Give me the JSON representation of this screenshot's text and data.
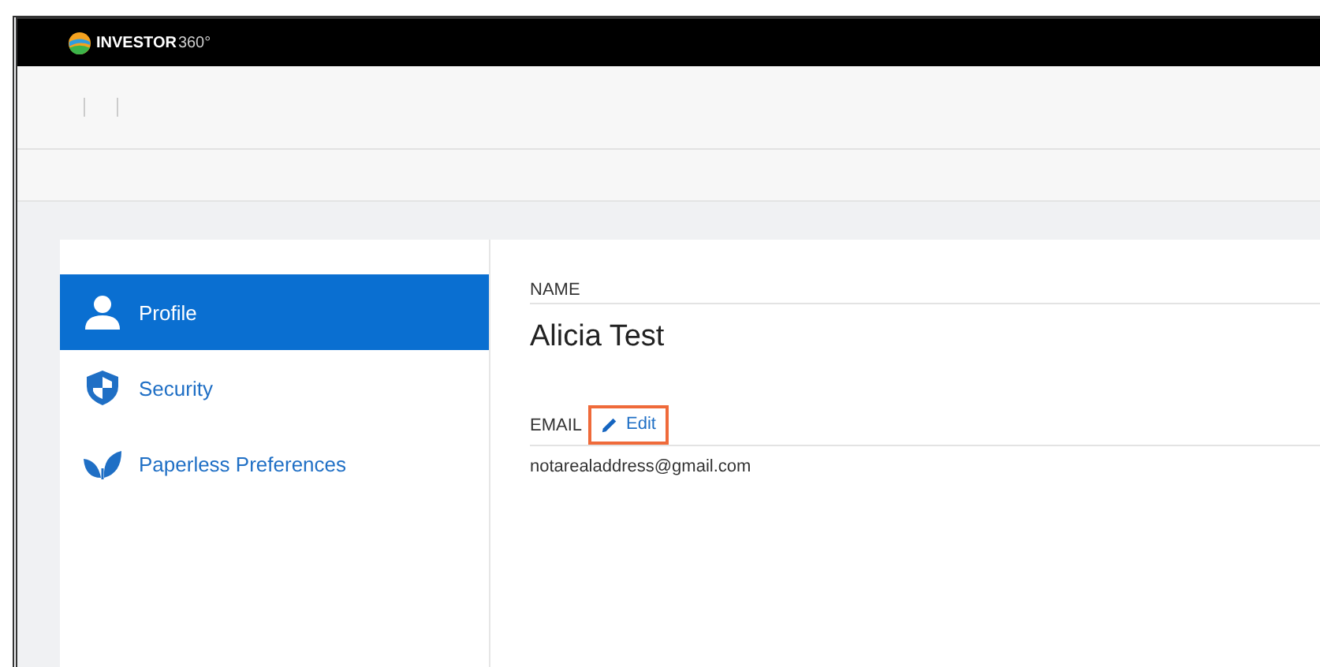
{
  "header": {
    "logo_text": "INVESTOR",
    "logo_suffix": "360°"
  },
  "sidebar": {
    "items": [
      {
        "label": "Profile",
        "selected": true
      },
      {
        "label": "Security",
        "selected": false
      },
      {
        "label": "Paperless Preferences",
        "selected": false
      }
    ]
  },
  "profile": {
    "name_label": "NAME",
    "name": "Alicia Test",
    "email_label": "EMAIL",
    "edit_link": {
      "label": "Edit",
      "highlighted": true
    },
    "email": "notarealaddress@gmail.com"
  }
}
